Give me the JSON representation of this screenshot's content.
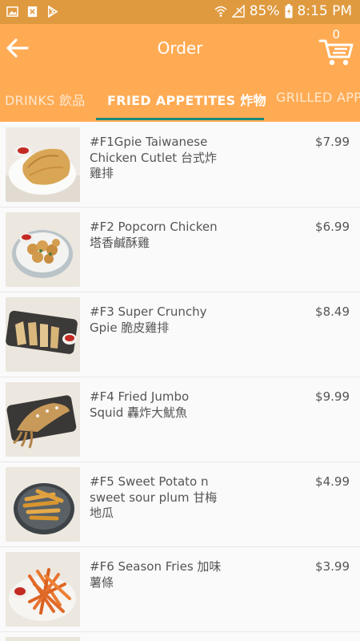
{
  "status_bar": {
    "battery": "85%",
    "time": "8:15 PM",
    "icons": [
      "gallery-icon",
      "document-icon",
      "play-store-icon",
      "wifi-icon",
      "signal-icon",
      "battery-icon"
    ]
  },
  "app_bar": {
    "title": "Order",
    "cart_count": "0",
    "icons": [
      "back-arrow-icon",
      "shopping-cart-icon"
    ]
  },
  "tabs": [
    {
      "label": "DRINKS 飲品",
      "active": false
    },
    {
      "label": "FRIED APPETITES 炸物",
      "active": true
    },
    {
      "label": "GRILLED APP",
      "active": false
    }
  ],
  "colors": {
    "status_bar": "#df9a40",
    "app_bar": "#ffab54",
    "tab_indicator": "#1a8a7a",
    "text": "#555555"
  },
  "items": [
    {
      "name": "#F1Gpie Taiwanese Chicken Cutlet 台式炸雞排",
      "price": "$7.99",
      "image": "chicken-cutlet-photo"
    },
    {
      "name": "#F2 Popcorn Chicken 塔香鹹酥雞",
      "price": "$6.99",
      "image": "popcorn-chicken-photo"
    },
    {
      "name": "#F3 Super Crunchy Gpie 脆皮雞排",
      "price": "$8.49",
      "image": "crunchy-chicken-photo"
    },
    {
      "name": "#F4 Fried Jumbo Squid 轟炸大魷魚",
      "price": "$9.99",
      "image": "fried-squid-photo"
    },
    {
      "name": "#F5 Sweet Potato n sweet sour plum 甘梅地瓜",
      "price": "$4.99",
      "image": "sweet-potato-photo"
    },
    {
      "name": "#F6 Season Fries 加味薯條",
      "price": "$3.99",
      "image": "season-fries-photo"
    }
  ]
}
